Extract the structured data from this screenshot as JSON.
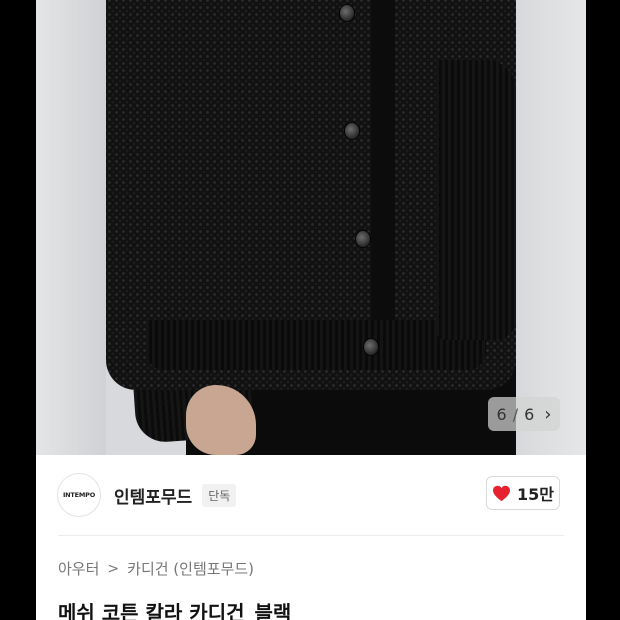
{
  "gallery": {
    "page_current": "6",
    "page_separator": "/",
    "page_total": "6",
    "next_icon": "chevron-right-icon"
  },
  "brand": {
    "logo_text": "INTEMPO",
    "name": "인템포무드",
    "badge": "단독"
  },
  "like": {
    "icon": "heart-icon",
    "icon_color": "#e8212e",
    "count": "15만"
  },
  "breadcrumb": {
    "category": "아우터",
    "subcategory": "카디건 (인템포무드)"
  },
  "product": {
    "title": "메쉬 코튼 칼라 카디건_블랙"
  }
}
